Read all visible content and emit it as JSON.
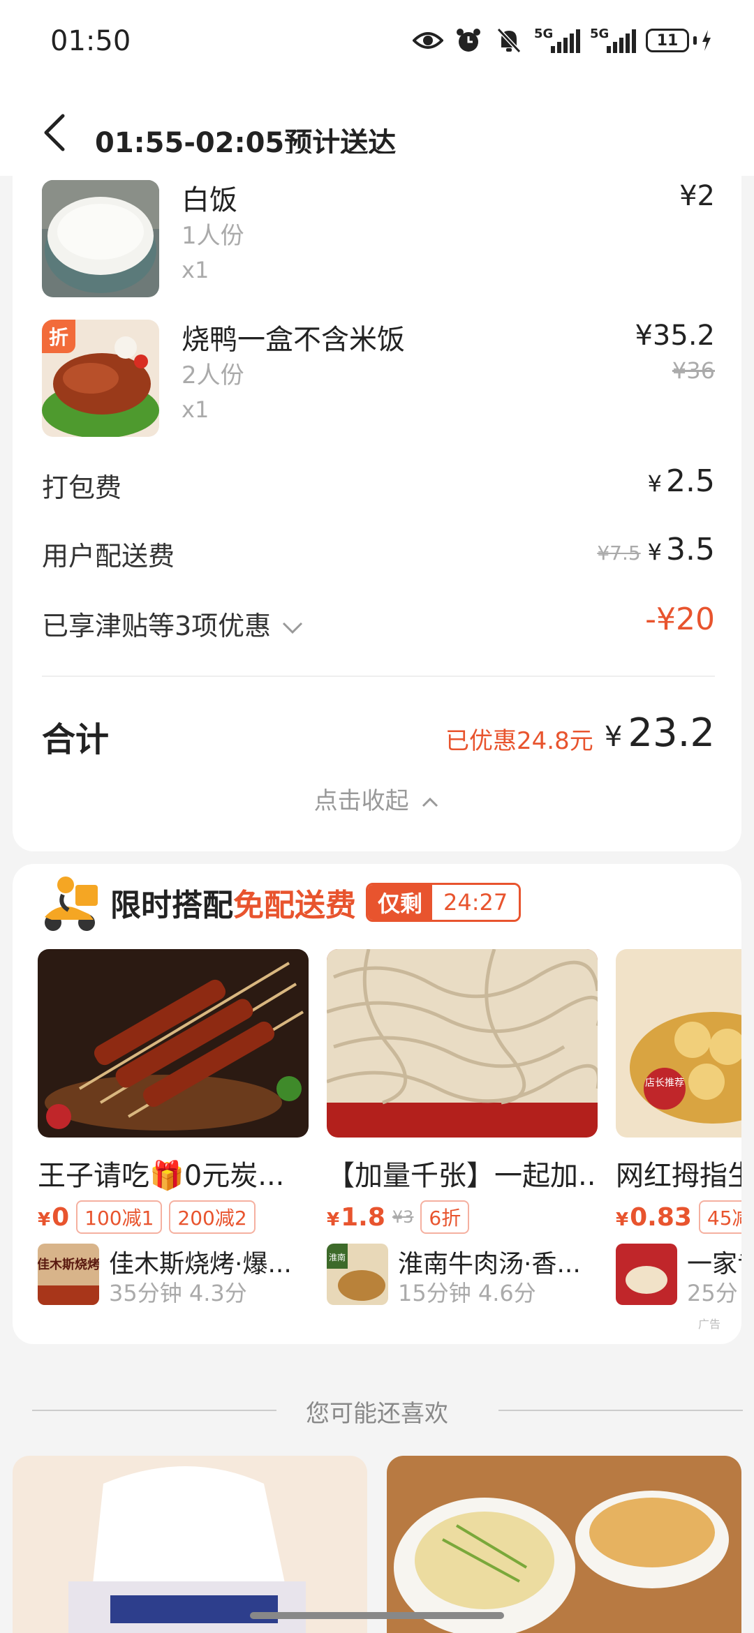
{
  "status": {
    "time": "01:50",
    "battery": "11",
    "net1": "5G",
    "net2": "5G"
  },
  "header": {
    "title": "01:55-02:05预计送达"
  },
  "items": [
    {
      "name": "白饭",
      "spec": "1人份",
      "qty": "x1",
      "price": "¥2"
    },
    {
      "name": "烧鸭一盒不含米饭",
      "spec": "2人份",
      "qty": "x1",
      "price": "¥35.2",
      "orig_price": "¥36",
      "tag": "折"
    }
  ],
  "fees": {
    "packing": {
      "label": "打包费",
      "yen": "¥",
      "value": "2.5"
    },
    "delivery": {
      "label": "用户配送费",
      "old": "¥7.5",
      "yen": "¥",
      "value": "3.5"
    },
    "discount": {
      "label": "已享津贴等3项优惠",
      "value": "-¥20"
    }
  },
  "total": {
    "label": "合计",
    "saved": "已优惠24.8元",
    "yen": "¥",
    "value": "23.2"
  },
  "collapse_label": "点击收起",
  "promo": {
    "title_prefix": "限时搭配",
    "title_highlight": "免配送费",
    "timer_label": "仅剩",
    "timer_value": "24:27",
    "ad": "广告",
    "products": [
      {
        "name": "王子请吃🎁0元炭...",
        "price_yen": "¥",
        "price": "0",
        "badges": [
          "100减1",
          "200减2"
        ],
        "shop": "佳木斯烧烤·爆...",
        "meta": "35分钟  4.3分",
        "shop_logo_text": "佳木斯烧烤"
      },
      {
        "name": "【加量千张】一起加...",
        "price_yen": "¥",
        "price": "1.8",
        "orig": "¥3",
        "badges": [
          "6折"
        ],
        "shop": "淮南牛肉汤·香...",
        "meta": "15分钟  4.6分",
        "shop_logo_text": "淮南"
      },
      {
        "name": "网红拇指生",
        "price_yen": "¥",
        "price": "0.83",
        "badges": [
          "45减"
        ],
        "shop": "一家专",
        "meta": "25分",
        "tag": "店长推荐"
      }
    ]
  },
  "recommend": {
    "title": "您可能还喜欢"
  },
  "colors": {
    "accent": "#e8542e",
    "bg": "#f4f4f4"
  }
}
